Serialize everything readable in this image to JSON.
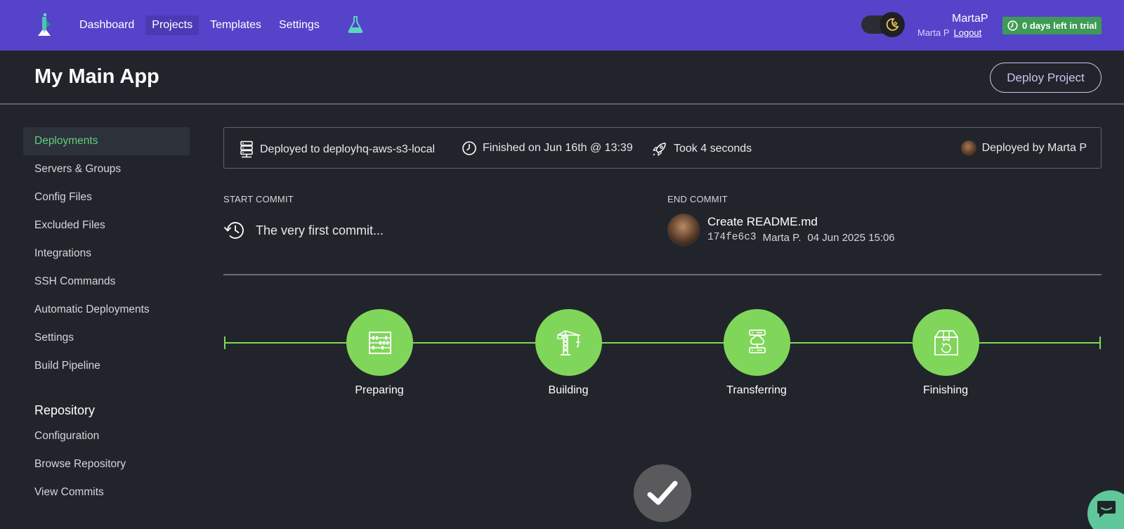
{
  "nav": {
    "items": [
      {
        "label": "Dashboard",
        "active": false
      },
      {
        "label": "Projects",
        "active": true
      },
      {
        "label": "Templates",
        "active": false
      },
      {
        "label": "Settings",
        "active": false
      }
    ]
  },
  "user": {
    "username": "MartaP",
    "full_name": "Marta P",
    "logout_label": "Logout",
    "trial_label": "0 days left in trial"
  },
  "header": {
    "title": "My Main App",
    "deploy_button": "Deploy Project"
  },
  "sidebar": {
    "items": [
      {
        "label": "Deployments",
        "active": true
      },
      {
        "label": "Servers & Groups"
      },
      {
        "label": "Config Files"
      },
      {
        "label": "Excluded Files"
      },
      {
        "label": "Integrations"
      },
      {
        "label": "SSH Commands"
      },
      {
        "label": "Automatic Deployments"
      },
      {
        "label": "Settings"
      },
      {
        "label": "Build Pipeline"
      }
    ],
    "repository_heading": "Repository",
    "repository_items": [
      {
        "label": "Configuration"
      },
      {
        "label": "Browse Repository"
      },
      {
        "label": "View Commits"
      }
    ]
  },
  "deployment": {
    "target": "Deployed to deployhq-aws-s3-local",
    "finished": "Finished on Jun 16th @ 13:39",
    "duration": "Took 4 seconds",
    "deployed_by": "Deployed by Marta P"
  },
  "commits": {
    "start_label": "START COMMIT",
    "start_text": "The very first commit...",
    "end_label": "END COMMIT",
    "end_title": "Create README.md",
    "end_hash": "174fe6c3",
    "end_author": "Marta P.",
    "end_date": "04 Jun 2025 15:06"
  },
  "pipeline": {
    "stages": [
      {
        "label": "Preparing",
        "icon": "abacus-icon"
      },
      {
        "label": "Building",
        "icon": "crane-icon"
      },
      {
        "label": "Transferring",
        "icon": "server-cloud-icon"
      },
      {
        "label": "Finishing",
        "icon": "package-icon"
      }
    ],
    "status_icon": "checkmark-icon"
  },
  "colors": {
    "topbar": "#5543c9",
    "background": "#21252b",
    "accent_green": "#80d65a",
    "active_sidebar_text": "#5fd17a",
    "trial_badge": "#3e9b55"
  }
}
